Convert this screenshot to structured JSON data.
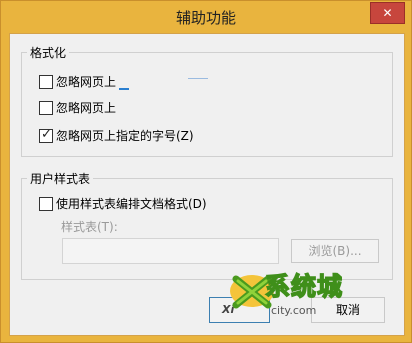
{
  "window": {
    "title": "辅助功能",
    "close_glyph": "✕"
  },
  "formatting": {
    "legend": "格式化",
    "items": [
      {
        "label": "忽略网页上",
        "checked": false
      },
      {
        "label": "忽略网页上",
        "checked": false
      },
      {
        "label": "忽略网页上指定的字号(Z)",
        "checked": true
      }
    ]
  },
  "stylesheet": {
    "legend": "用户样式表",
    "use_label": "使用样式表编排文档格式(D)",
    "use_checked": false,
    "file_label": "样式表(T):",
    "file_value": "",
    "browse_label": "浏览(B)..."
  },
  "buttons": {
    "ok_label": "",
    "cancel_label": "取消"
  },
  "watermark": {
    "brand": "系统城",
    "site": "xitongcheng.com",
    "domain_suffix": "city.com",
    "x_letter": "X",
    "wm_prefix": "Xi"
  },
  "icons": {
    "check": "✓",
    "close": "close-icon",
    "checkbox": "checkbox-icon",
    "logo": "xitongcheng-logo"
  },
  "colors": {
    "frame": "#e9b43e",
    "close_bg": "#c7463d",
    "focus_border": "#3c7fb1"
  }
}
